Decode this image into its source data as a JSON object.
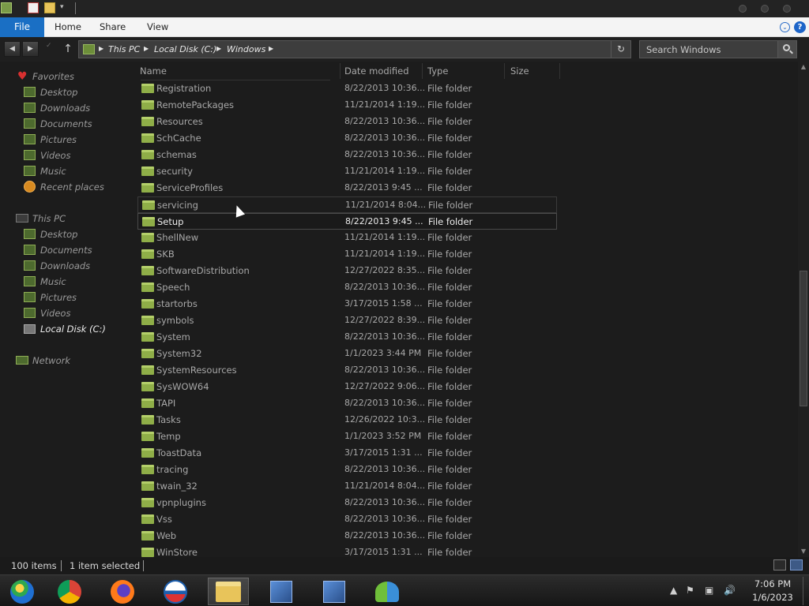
{
  "ribbon": {
    "tabs": [
      {
        "label": "File",
        "active": true
      },
      {
        "label": "Home"
      },
      {
        "label": "Share"
      },
      {
        "label": "View"
      }
    ],
    "accent_color": "#1a6fc4"
  },
  "address": {
    "crumbs": [
      "This PC",
      "Local Disk (C:)",
      "Windows"
    ]
  },
  "search": {
    "placeholder": "Search Windows"
  },
  "sidebar": {
    "favorites": {
      "label": "Favorites",
      "items": [
        "Desktop",
        "Downloads",
        "Documents",
        "Pictures",
        "Videos",
        "Music",
        "Recent places"
      ]
    },
    "this_pc": {
      "label": "This PC",
      "items": [
        "Desktop",
        "Documents",
        "Downloads",
        "Music",
        "Pictures",
        "Videos",
        "Local Disk (C:)"
      ]
    },
    "network": {
      "label": "Network"
    }
  },
  "columns": [
    "Name",
    "Date modified",
    "Type",
    "Size"
  ],
  "files": [
    {
      "name": "Registration",
      "date": "8/22/2013 10:36...",
      "type": "File folder"
    },
    {
      "name": "RemotePackages",
      "date": "11/21/2014 1:19...",
      "type": "File folder"
    },
    {
      "name": "Resources",
      "date": "8/22/2013 10:36...",
      "type": "File folder"
    },
    {
      "name": "SchCache",
      "date": "8/22/2013 10:36...",
      "type": "File folder"
    },
    {
      "name": "schemas",
      "date": "8/22/2013 10:36...",
      "type": "File folder"
    },
    {
      "name": "security",
      "date": "11/21/2014 1:19...",
      "type": "File folder"
    },
    {
      "name": "ServiceProfiles",
      "date": "8/22/2013 9:45 ...",
      "type": "File folder"
    },
    {
      "name": "servicing",
      "date": "11/21/2014 8:04...",
      "type": "File folder",
      "hover": true
    },
    {
      "name": "Setup",
      "date": "8/22/2013 9:45 ...",
      "type": "File folder",
      "selected": true
    },
    {
      "name": "ShellNew",
      "date": "11/21/2014 1:19...",
      "type": "File folder"
    },
    {
      "name": "SKB",
      "date": "11/21/2014 1:19...",
      "type": "File folder"
    },
    {
      "name": "SoftwareDistribution",
      "date": "12/27/2022 8:35...",
      "type": "File folder"
    },
    {
      "name": "Speech",
      "date": "8/22/2013 10:36...",
      "type": "File folder"
    },
    {
      "name": "startorbs",
      "date": "3/17/2015 1:58 ...",
      "type": "File folder"
    },
    {
      "name": "symbols",
      "date": "12/27/2022 8:39...",
      "type": "File folder"
    },
    {
      "name": "System",
      "date": "8/22/2013 10:36...",
      "type": "File folder"
    },
    {
      "name": "System32",
      "date": "1/1/2023 3:44 PM",
      "type": "File folder"
    },
    {
      "name": "SystemResources",
      "date": "8/22/2013 10:36...",
      "type": "File folder"
    },
    {
      "name": "SysWOW64",
      "date": "12/27/2022 9:06...",
      "type": "File folder"
    },
    {
      "name": "TAPI",
      "date": "8/22/2013 10:36...",
      "type": "File folder"
    },
    {
      "name": "Tasks",
      "date": "12/26/2022 10:3...",
      "type": "File folder"
    },
    {
      "name": "Temp",
      "date": "1/1/2023 3:52 PM",
      "type": "File folder"
    },
    {
      "name": "ToastData",
      "date": "3/17/2015 1:31 ...",
      "type": "File folder"
    },
    {
      "name": "tracing",
      "date": "8/22/2013 10:36...",
      "type": "File folder"
    },
    {
      "name": "twain_32",
      "date": "11/21/2014 8:04...",
      "type": "File folder"
    },
    {
      "name": "vpnplugins",
      "date": "8/22/2013 10:36...",
      "type": "File folder"
    },
    {
      "name": "Vss",
      "date": "8/22/2013 10:36...",
      "type": "File folder"
    },
    {
      "name": "Web",
      "date": "8/22/2013 10:36...",
      "type": "File folder"
    },
    {
      "name": "WinStore",
      "date": "3/17/2015 1:31 ...",
      "type": "File folder"
    }
  ],
  "status": {
    "item_count": "100 items",
    "selection": "1 item selected"
  },
  "taskbar": {
    "apps": [
      {
        "name": "start-orb-icon",
        "color": "#1f6fd1"
      },
      {
        "name": "chrome-icon",
        "color": "#db4437"
      },
      {
        "name": "firefox-icon",
        "color": "#ff7a1a"
      },
      {
        "name": "obama-logo-icon",
        "color": "#1d5fae"
      },
      {
        "name": "file-explorer-icon",
        "color": "#e8c45a",
        "active": true
      },
      {
        "name": "network-setup-icon",
        "color": "#5a8fd8"
      },
      {
        "name": "network-setup-2-icon",
        "color": "#5a8fd8"
      },
      {
        "name": "users-icon",
        "color": "#6fbf3a"
      }
    ]
  },
  "clock": {
    "time": "7:06 PM",
    "date": "1/6/2023"
  }
}
